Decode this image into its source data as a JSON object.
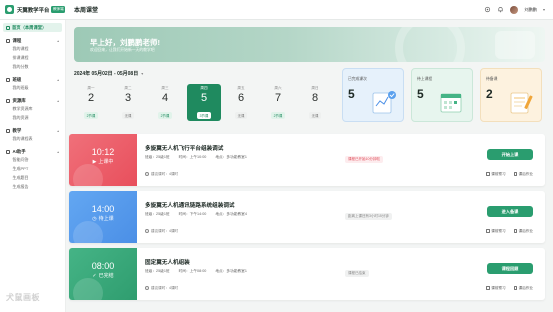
{
  "app": {
    "name": "天翼教学平台",
    "badge": "教师端",
    "page_title": "本周课堂"
  },
  "user": {
    "name": "刘鹏鹏"
  },
  "sidebar": {
    "home": "首页（本周课堂）",
    "groups": [
      {
        "title": "课程",
        "items": [
          "我的课程",
          "排课课程",
          "我的分数"
        ]
      },
      {
        "title": "班级",
        "items": [
          "我的班级"
        ]
      },
      {
        "title": "资源库",
        "items": [
          "教学资源库",
          "我的资源"
        ]
      },
      {
        "title": "教学",
        "items": [
          "我的课程表"
        ]
      },
      {
        "title": "AI助手",
        "items": [
          "智能问答",
          "生成PPT",
          "生成题目",
          "生成报告"
        ]
      }
    ]
  },
  "banner": {
    "greeting": "早上好，刘鹏鹏老师!",
    "subtitle": "欢迎回来，让我们开始新一天的教学吧"
  },
  "week": {
    "range": "2024年  05月02日 - 05月08日",
    "days": [
      {
        "weekday": "周一",
        "num": "2",
        "badge": "2节课",
        "style": "green"
      },
      {
        "weekday": "周二",
        "num": "3",
        "badge": "无课",
        "style": "gray"
      },
      {
        "weekday": "周三",
        "num": "4",
        "badge": "2节课",
        "style": "green"
      },
      {
        "weekday": "周四",
        "num": "5",
        "badge": "3节课",
        "style": "active"
      },
      {
        "weekday": "周五",
        "num": "6",
        "badge": "无课",
        "style": "gray"
      },
      {
        "weekday": "周六",
        "num": "7",
        "badge": "2节课",
        "style": "green"
      },
      {
        "weekday": "周日",
        "num": "8",
        "badge": "无课",
        "style": "gray"
      }
    ]
  },
  "stats": [
    {
      "label": "已完成课次",
      "value": "5",
      "bg": "#e6f1fb",
      "border": "#c9def3"
    },
    {
      "label": "待上课程",
      "value": "5",
      "bg": "#e7f5ee",
      "border": "#cbe7d9"
    },
    {
      "label": "待备课",
      "value": "2",
      "bg": "#fdf2df",
      "border": "#f3dfbc"
    }
  ],
  "courses": [
    {
      "time": "10:12",
      "state": "上课中",
      "theme": "red",
      "title": "多旋翼无人机飞行平台组装调试",
      "meta": [
        "班级：25级1班",
        "时间：上午10:00",
        "地点：多功能教室1"
      ],
      "duration": "建议课时：4课时",
      "status": "课程已开始10分钟啦",
      "status_style": "red",
      "button": "开始上课",
      "link1": "课前预习",
      "link2": "课后作业"
    },
    {
      "time": "14:00",
      "state": "待上课",
      "theme": "blue",
      "title": "多旋翼无人机通讯链路系统组装调试",
      "meta": [
        "班级：25级1班",
        "时间：下午14:00",
        "地点：多功能教室4"
      ],
      "duration": "建议课时：4课时",
      "status": "距离上课还有3小时15分钟",
      "status_style": "gray",
      "button": "进入备课",
      "link1": "课前预习",
      "link2": "课后作业"
    },
    {
      "time": "08:00",
      "state": "已完结",
      "theme": "green",
      "title": "固定翼无人机组装",
      "meta": [
        "班级：25级1班",
        "时间：上午08:00",
        "地点：多功能教室1"
      ],
      "duration": "建议课时：4课时",
      "status": "课程已结束",
      "status_style": "gray",
      "button": "课程回顾",
      "link1": "课前预习",
      "link2": "课后作业"
    }
  ],
  "watermark": "犬鼠画板"
}
